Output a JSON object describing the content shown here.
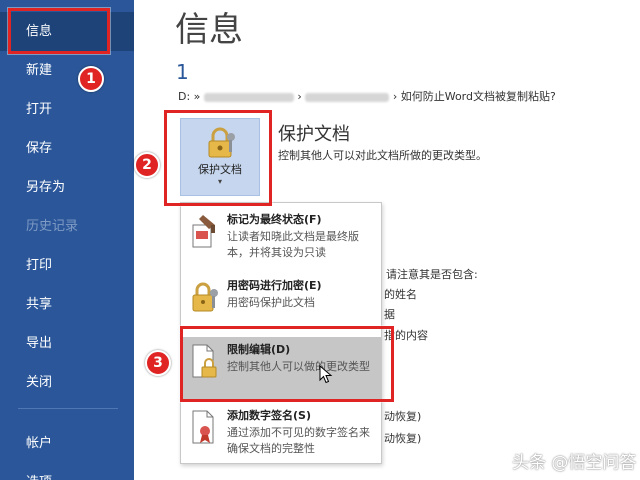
{
  "sidebar": {
    "items": [
      {
        "label": "信息"
      },
      {
        "label": "新建"
      },
      {
        "label": "打开"
      },
      {
        "label": "保存"
      },
      {
        "label": "另存为"
      },
      {
        "label": "历史记录"
      },
      {
        "label": "打印"
      },
      {
        "label": "共享"
      },
      {
        "label": "导出"
      },
      {
        "label": "关闭"
      },
      {
        "label": "帐户"
      },
      {
        "label": "选项"
      }
    ],
    "bg_color": "#2b579a"
  },
  "main": {
    "title": "信息",
    "doc_name": "1",
    "path_prefix": "D: »",
    "path_sep1": "›",
    "path_suffix": "› 如何防止Word文档被复制粘贴?",
    "protect": {
      "button_label": "保护文档",
      "arrow": "▾",
      "heading": "保护文档",
      "description": "控制其他人可以对此文档所做的更改类型。"
    },
    "background_fragments": [
      "请注意其是否包含:",
      "的姓名",
      "据",
      "指的内容",
      "动恢复)",
      "动恢复)"
    ]
  },
  "menu": {
    "items": [
      {
        "title": "标记为最终状态(F)",
        "desc": "让读者知晓此文档是最终版本，并将其设为只读"
      },
      {
        "title": "用密码进行加密(E)",
        "desc": "用密码保护此文档"
      },
      {
        "title": "限制编辑(D)",
        "desc": "控制其他人可以做的更改类型"
      },
      {
        "title": "添加数字签名(S)",
        "desc": "通过添加不可见的数字签名来确保文档的完整性"
      }
    ]
  },
  "annotations": {
    "badges": [
      "1",
      "2",
      "3"
    ],
    "color": "#e02424"
  },
  "watermark": "头条 @悟空问答"
}
